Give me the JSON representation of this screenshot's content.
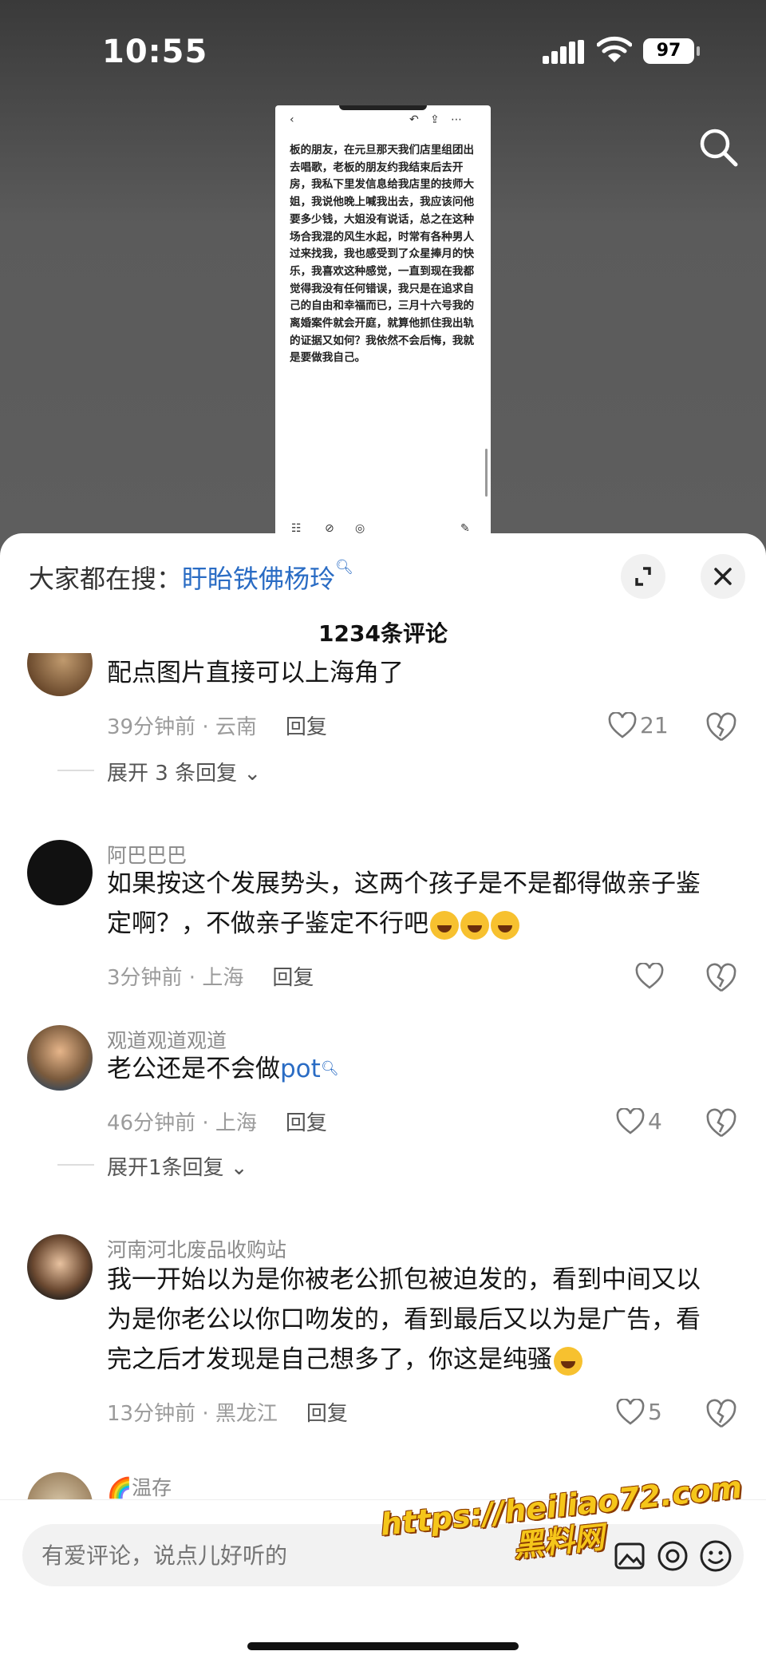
{
  "status_bar": {
    "time": "10:55",
    "battery": "97"
  },
  "thumbnail": {
    "text": "板的朋友，在元旦那天我们店里组团出去唱歌，老板的朋友约我结束后去开房，我私下里发信息给我店里的技师大姐，我说他晚上喊我出去，我应该问他要多少钱，大姐没有说话，总之在这种场合我混的风生水起，时常有各种男人过来找我，我也感受到了众星捧月的快乐，我喜欢这种感觉，一直到现在我都觉得我没有任何错误，我只是在追求自己的自由和幸福而已，三月十六号我的离婚案件就会开庭，就算他抓住我出轨的证据又如何？我依然不会后悔，我就是要做我自己。"
  },
  "sheet": {
    "hot_search_prefix": "大家都在搜：",
    "hot_search_term": "盱眙铁佛杨玲",
    "comment_count": "1234条评论",
    "comments": [
      {
        "user": "",
        "text": "配点图片直接可以上海角了",
        "time_loc": "39分钟前 · 云南",
        "reply": "回复",
        "likes": "21",
        "expand": "展开 3 条回复"
      },
      {
        "user": "阿巴巴巴",
        "text": "如果按这个发展势头，这两个孩子是不是都得做亲子鉴定啊？，不做亲子鉴定不行吧",
        "time_loc": "3分钟前 · 上海",
        "reply": "回复",
        "likes": ""
      },
      {
        "user": "观道观道观道",
        "text": "老公还是不会做",
        "link": "pot",
        "time_loc": "46分钟前 · 上海",
        "reply": "回复",
        "likes": "4",
        "expand": "展开1条回复"
      },
      {
        "user": "河南河北废品收购站",
        "text": "我一开始以为是你被老公抓包被迫发的，看到中间又以为是你老公以你口吻发的，看到最后又以为是广告，看完之后才发现是自己想多了，你这是纯骚",
        "time_loc": "13分钟前 · 黑龙江",
        "reply": "回复",
        "likes": "5"
      },
      {
        "user": "🌈温存"
      }
    ]
  },
  "input": {
    "placeholder": "有爱评论，说点儿好听的"
  },
  "watermark": {
    "line1": "https://heiliao72.com",
    "line2": "黑料网"
  },
  "colors": {
    "link": "#2a6cc4",
    "watermark": "#f5c61a"
  }
}
